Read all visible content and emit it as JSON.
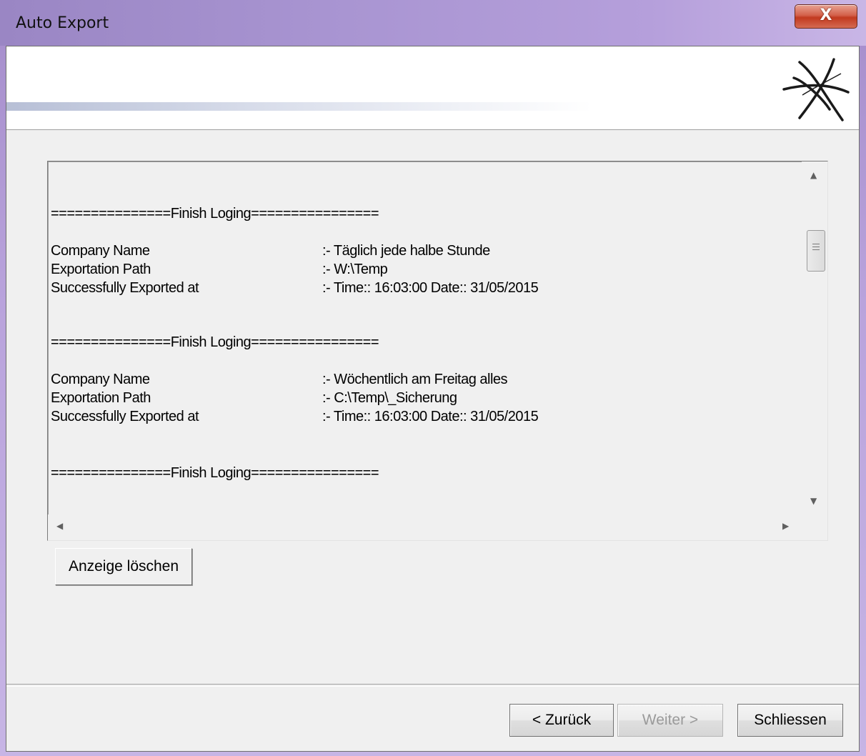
{
  "window": {
    "title": "Auto Export",
    "close_label": "X"
  },
  "log": {
    "separator": "===============Finish Loging================",
    "entries": [
      {
        "company_label": "Company Name",
        "company_value": ":- Täglich jede halbe Stunde",
        "path_label": "Exportation Path",
        "path_value": ":- W:\\Temp",
        "exported_label": "Successfully Exported at",
        "exported_value": ":- Time:: 16:03:00 Date:: 31/05/2015"
      },
      {
        "company_label": "Company Name",
        "company_value": ":- Wöchentlich am Freitag alles",
        "path_label": "Exportation Path",
        "path_value": ":- C:\\Temp\\_Sicherung",
        "exported_label": "Successfully Exported at",
        "exported_value": ":- Time:: 16:03:00 Date:: 31/05/2015"
      }
    ]
  },
  "scrollbar": {
    "up_arrow": "▲",
    "down_arrow": "▼",
    "left_arrow": "◀",
    "right_arrow": "▶"
  },
  "buttons": {
    "clear_display": "Anzeige löschen",
    "back": "< Zurück",
    "next": "Weiter >",
    "close": "Schliessen"
  }
}
